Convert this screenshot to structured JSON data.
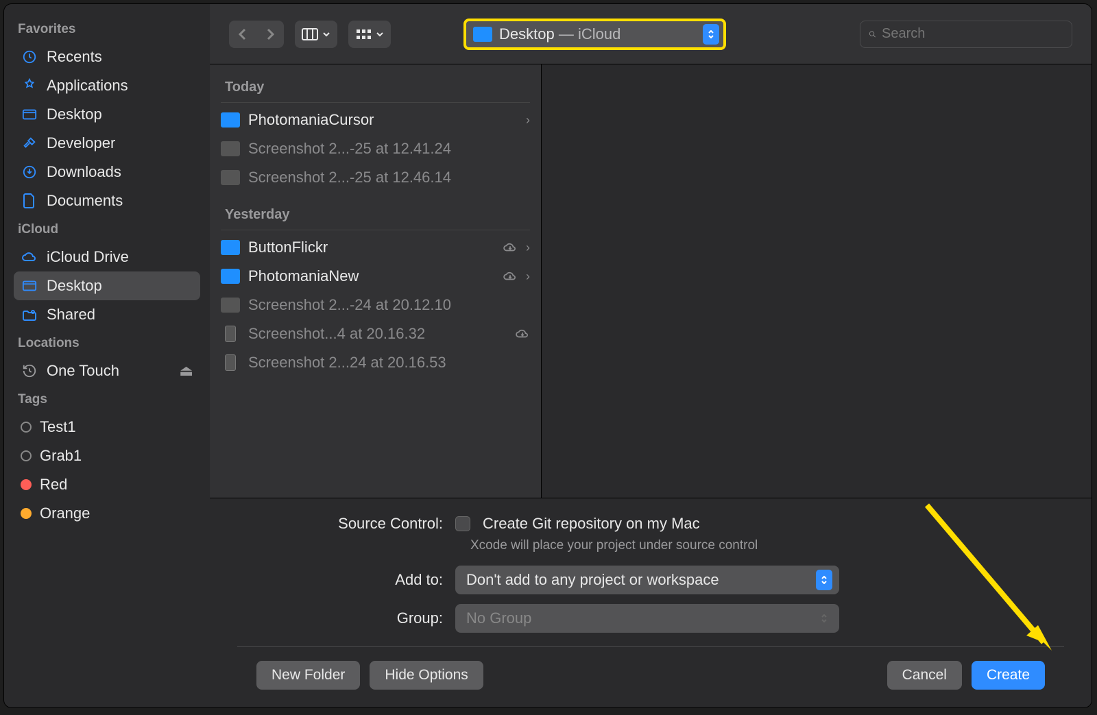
{
  "sidebar": {
    "sections": {
      "favorites": {
        "title": "Favorites",
        "items": [
          {
            "label": "Recents",
            "icon": "clock"
          },
          {
            "label": "Applications",
            "icon": "apps"
          },
          {
            "label": "Desktop",
            "icon": "desktop"
          },
          {
            "label": "Developer",
            "icon": "hammer"
          },
          {
            "label": "Downloads",
            "icon": "download"
          },
          {
            "label": "Documents",
            "icon": "doc"
          }
        ]
      },
      "icloud": {
        "title": "iCloud",
        "items": [
          {
            "label": "iCloud Drive",
            "icon": "cloud"
          },
          {
            "label": "Desktop",
            "icon": "desktop",
            "active": true
          },
          {
            "label": "Shared",
            "icon": "shared"
          }
        ]
      },
      "locations": {
        "title": "Locations",
        "items": [
          {
            "label": "One Touch",
            "icon": "history",
            "eject": true
          }
        ]
      },
      "tags": {
        "title": "Tags",
        "items": [
          {
            "label": "Test1",
            "color": ""
          },
          {
            "label": "Grab1",
            "color": ""
          },
          {
            "label": "Red",
            "color": "red"
          },
          {
            "label": "Orange",
            "color": "orange"
          }
        ]
      }
    }
  },
  "toolbar": {
    "path_folder": "Desktop",
    "path_separator": " — ",
    "path_location": "iCloud",
    "search_placeholder": "Search"
  },
  "browser": {
    "groups": [
      {
        "title": "Today",
        "items": [
          {
            "name": "PhotomaniaCursor",
            "kind": "folder",
            "chev": true
          },
          {
            "name": "Screenshot 2...-25 at 12.41.24",
            "kind": "file",
            "dim": true
          },
          {
            "name": "Screenshot 2...-25 at 12.46.14",
            "kind": "file",
            "dim": true
          }
        ]
      },
      {
        "title": "Yesterday",
        "items": [
          {
            "name": "ButtonFlickr",
            "kind": "folder",
            "chev": true,
            "cloud": true
          },
          {
            "name": "PhotomaniaNew",
            "kind": "folder",
            "chev": true,
            "cloud": true
          },
          {
            "name": "Screenshot 2...-24 at 20.12.10",
            "kind": "file",
            "dim": true
          },
          {
            "name": "Screenshot...4 at 20.16.32",
            "kind": "phone",
            "dim": true,
            "cloud": true
          },
          {
            "name": "Screenshot 2...24 at 20.16.53",
            "kind": "phone",
            "dim": true
          }
        ]
      }
    ]
  },
  "options": {
    "source_control_label": "Source Control:",
    "git_checkbox_label": "Create Git repository on my Mac",
    "git_subtext": "Xcode will place your project under source control",
    "add_to_label": "Add to:",
    "add_to_value": "Don't add to any project or workspace",
    "group_label": "Group:",
    "group_value": "No Group"
  },
  "buttons": {
    "new_folder": "New Folder",
    "hide_options": "Hide Options",
    "cancel": "Cancel",
    "create": "Create"
  }
}
